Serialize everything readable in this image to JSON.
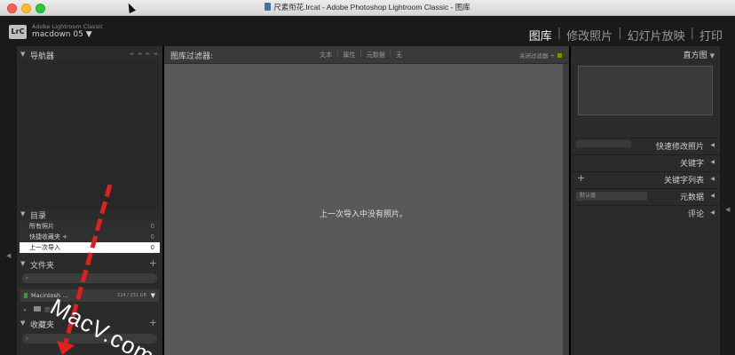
{
  "window": {
    "title": "尺素衔花.lrcat - Adobe Photoshop Lightroom Classic - 图库"
  },
  "identity": {
    "logo": "LrC",
    "app_name": "Adobe Lightroom Classic",
    "user": "macdown 05 ▼"
  },
  "modules": [
    {
      "label": "图库",
      "active": true
    },
    {
      "label": "修改照片",
      "active": false
    },
    {
      "label": "幻灯片放映",
      "active": false
    },
    {
      "label": "打印",
      "active": false
    }
  ],
  "left_panel": {
    "navigator": {
      "label": "导航器"
    },
    "catalog": {
      "label": "目录",
      "items": [
        {
          "label": "所有照片",
          "count": "0"
        },
        {
          "label": "快捷收藏夹 +",
          "count": "0"
        },
        {
          "label": "上一次导入",
          "count": "0"
        }
      ]
    },
    "folders": {
      "label": "文件夹",
      "volume": {
        "name": "Macintosh ...",
        "size": "124 / 251 GB"
      },
      "folder": "图片"
    },
    "collections": {
      "label": "收藏夹"
    }
  },
  "filter_bar": {
    "title": "图库过滤器:",
    "tabs": [
      "文本",
      "属性",
      "元数据",
      "无"
    ],
    "off_label": "关闭过滤器"
  },
  "center": {
    "empty_message": "上一次导入中没有照片。"
  },
  "right_panel": {
    "histogram": {
      "label": "直方图"
    },
    "quick_develop": {
      "label": "快速修改照片"
    },
    "keywording": {
      "label": "关键字"
    },
    "keyword_list": {
      "label": "关键字列表"
    },
    "metadata": {
      "label": "元数据",
      "preset": "默认值"
    },
    "comments": {
      "label": "评论"
    }
  },
  "watermark": "MacV.com",
  "colors": {
    "annotation_arrow": "#e0201c",
    "selected_row": "#ffffff",
    "center_bg": "#595959"
  }
}
